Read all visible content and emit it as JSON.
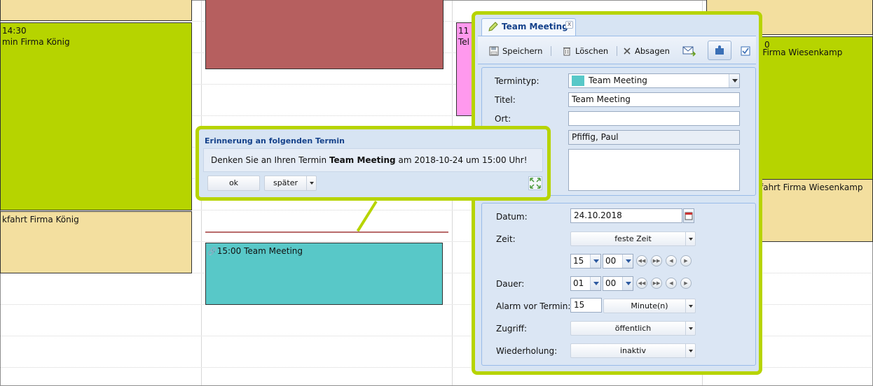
{
  "calendar": {
    "events": [
      {
        "id": "top-left",
        "time": "",
        "title": "",
        "color": "#f3df9f"
      },
      {
        "id": "green-left",
        "time": "14:30",
        "title": "min Firma König",
        "color": "#b6d400"
      },
      {
        "id": "yellow-left",
        "time": "",
        "title": "kfahrt Firma König",
        "color": "#f3df9f"
      },
      {
        "id": "red",
        "time": "",
        "title": "",
        "color": "#b65f5f"
      },
      {
        "id": "pink-11",
        "time": "11",
        "title": "Tel",
        "color": "#ff99ee"
      },
      {
        "id": "teal",
        "time": "",
        "title": "15:00 Team Meeting",
        "color": "#58c8c8"
      },
      {
        "id": "right-top",
        "time": "",
        "title": "",
        "color": "#f3df9f"
      },
      {
        "id": "green-right",
        "time": "0",
        "title": "n Firma Wiesenkamp",
        "color": "#b6d400"
      },
      {
        "id": "yellow-right",
        "time": "",
        "title": "fahrt Firma Wiesenkamp",
        "color": "#f3df9f"
      }
    ]
  },
  "reminder": {
    "title": "Erinnerung an folgenden Termin",
    "message_prefix": "Denken Sie an Ihren Termin ",
    "message_bold": "Team Meeting",
    "message_suffix": " am 2018-10-24 um 15:00 Uhr!",
    "ok_label": "ok",
    "later_label": "später"
  },
  "editor": {
    "tab_label": "Team Meeting",
    "toolbar": {
      "save_label": "Speichern",
      "delete_label": "Löschen",
      "cancel_label": "Absagen"
    },
    "fields": {
      "type_label": "Termintyp:",
      "type_value": "Team Meeting",
      "type_color": "#58c8c8",
      "title_label": "Titel:",
      "title_value": "Team Meeting",
      "place_label": "Ort:",
      "place_value": "",
      "owner_value": "Pfiffig, Paul",
      "notes_value": "",
      "date_label": "Datum:",
      "date_value": "24.10.2018",
      "time_label": "Zeit:",
      "time_mode": "feste Zeit",
      "hour": "15",
      "minute": "00",
      "duration_label": "Dauer:",
      "duration_hours": "01",
      "duration_minutes": "00",
      "alarm_label": "Alarm vor Termin:",
      "alarm_value": "15",
      "alarm_unit": "Minute(n)",
      "access_label": "Zugriff:",
      "access_value": "öffentlich",
      "repeat_label": "Wiederholung:",
      "repeat_value": "inaktiv"
    }
  },
  "colors": {
    "frame_green": "#b7d400",
    "panel_blue": "#d7e4f3",
    "title_blue": "#15428b"
  }
}
